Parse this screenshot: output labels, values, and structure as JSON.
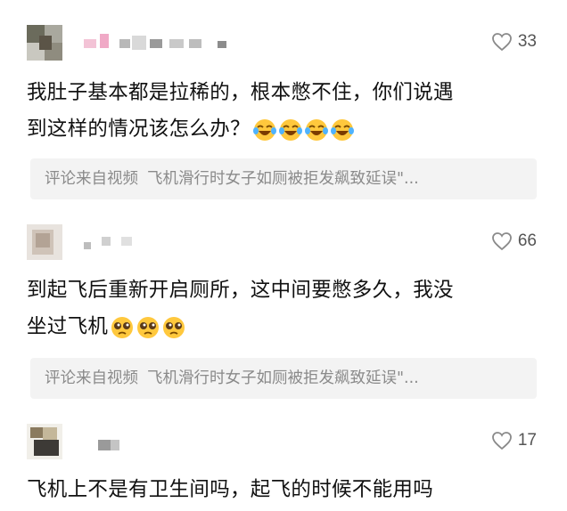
{
  "comments": [
    {
      "likes": "33",
      "text": "我肚子基本都是拉稀的，根本憋不住，你们说遇到这样的情况该怎么办？",
      "text_line1": "我肚子基本都是拉稀的，根本憋不住，你们说遇",
      "text_line2": "到这样的情况该怎么办？",
      "emoji_name": "laugh-cry-emoji",
      "emoji_count": 4,
      "source_prefix": "评论来自视频",
      "source_title": "飞机滑行时女子如厕被拒发飙致延误\"..."
    },
    {
      "likes": "66",
      "text_line1": "到起飞后重新开启厕所，这中间要憋多久，我没",
      "text_line2": "坐过飞机",
      "emoji_name": "pleading-face-emoji",
      "emoji_count": 3,
      "source_prefix": "评论来自视频",
      "source_title": "飞机滑行时女子如厕被拒发飙致延误\"..."
    },
    {
      "likes": "17",
      "text_line1": "飞机上不是有卫生间吗，起飞的时候不能用吗"
    }
  ],
  "colors": {
    "like_icon": "#8a8a8a",
    "source_bg": "#f3f3f3",
    "source_text": "#8a8a8a",
    "body_text": "#111111"
  }
}
